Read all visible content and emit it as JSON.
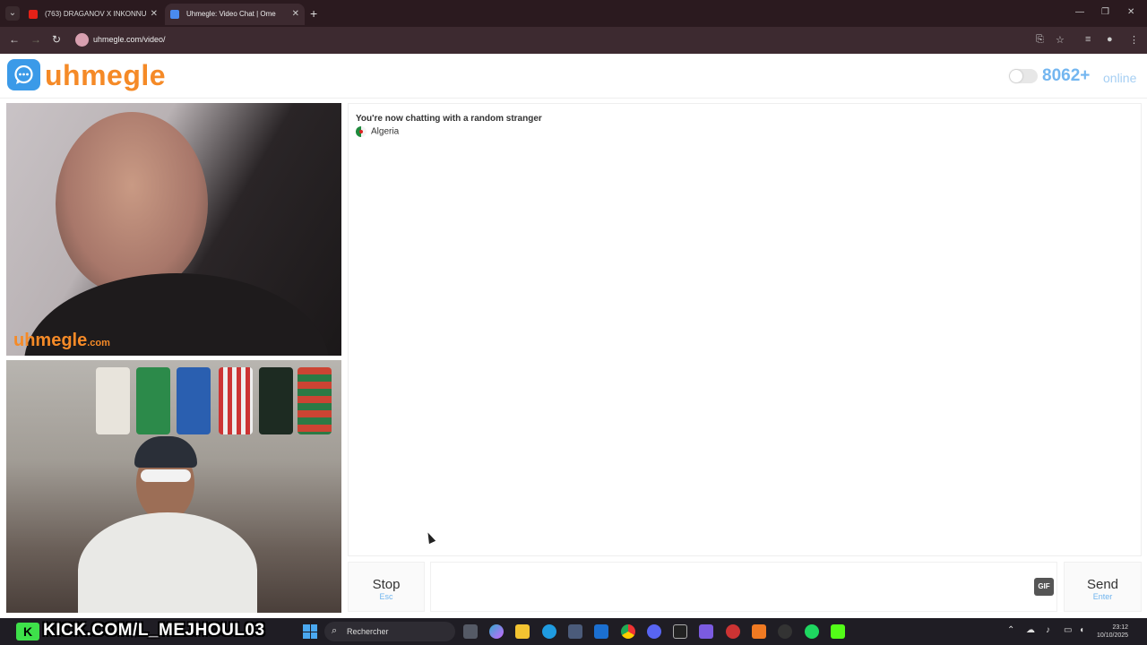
{
  "browser": {
    "tabs": [
      {
        "label": "(763) DRAGANOV X INKONNU",
        "color": "#e62117"
      },
      {
        "label": "Uhmegle: Video Chat | Ome",
        "color": "#4a8bef"
      }
    ],
    "url": "uhmegle.com/video/"
  },
  "site": {
    "logo_text": "uhmegle",
    "online_count": "8062+",
    "online_label": "online",
    "accent_color": "#f58a27",
    "brand_blue": "#3b9ae8"
  },
  "video": {
    "watermark_main": "uhmegle",
    "watermark_suffix": ".com"
  },
  "chat": {
    "status": "You're now chatting with a random stranger",
    "country": "Algeria"
  },
  "controls": {
    "stop_label": "Stop",
    "stop_hint": "Esc",
    "send_label": "Send",
    "send_hint": "Enter",
    "gif_label": "GIF"
  },
  "overlay": {
    "kick_text": "KICK.COM/L_MEJHOUL03"
  },
  "taskbar": {
    "search_placeholder": "Rechercher",
    "time": "23:12",
    "date": "10/10/2025"
  }
}
